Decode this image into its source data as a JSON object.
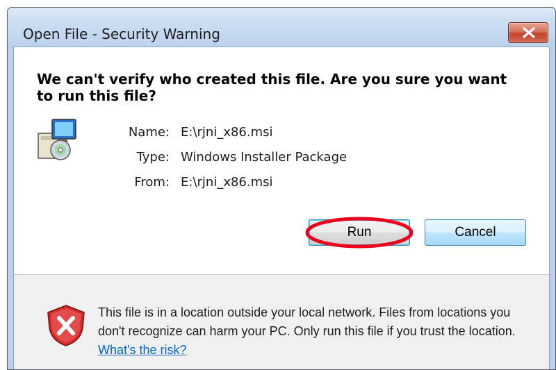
{
  "window": {
    "title": "Open File - Security Warning"
  },
  "dialog": {
    "headline": "We can't verify who created this file. Are you sure you want to run this file?",
    "fields": [
      {
        "label": "Name:",
        "value": "E:\\rjni_x86.msi"
      },
      {
        "label": "Type:",
        "value": "Windows Installer Package"
      },
      {
        "label": "From:",
        "value": "E:\\rjni_x86.msi"
      }
    ],
    "run_label": "Run",
    "cancel_label": "Cancel",
    "footer_text": "This file is in a location outside your local network. Files from locations you don't recognize can harm your PC. Only run this file if you trust the location.",
    "risk_link": "What's the risk?"
  },
  "icons": {
    "package": "installer-package-icon",
    "shield": "security-shield-icon",
    "close": "close-icon"
  },
  "colors": {
    "highlight_ring": "#e8001c",
    "link": "#0066cc",
    "close_button": "#c2432b"
  }
}
